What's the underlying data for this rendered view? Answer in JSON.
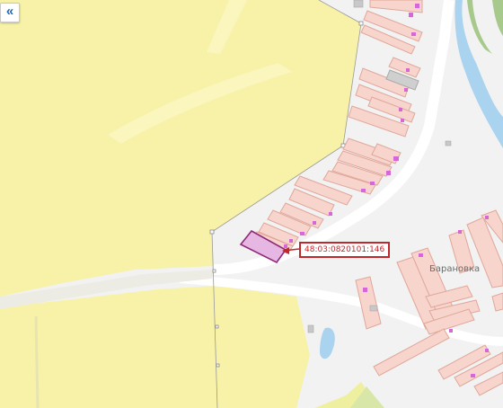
{
  "controls": {
    "collapse_symbol": "«",
    "collapse_icon": "double-chevron-left-icon"
  },
  "parcel": {
    "cadastral_number": "48:03:0820101:146"
  },
  "places": {
    "settlement_name": "Барановка"
  },
  "colors": {
    "background": "#f2f2f2",
    "field_yellow": "#f7f2a8",
    "forest_yellow": "#f3ee9b",
    "road_white": "#ffffff",
    "building_fill": "#f7d4cc",
    "building_stroke": "#e0a79a",
    "water": "#a9d3ee",
    "green": "#a7c98b",
    "selected_parcel_fill": "#e6b7e3",
    "selected_parcel_stroke": "#8f2a78",
    "highlight": "#c0282b",
    "boundary": "#9a9a9a"
  }
}
